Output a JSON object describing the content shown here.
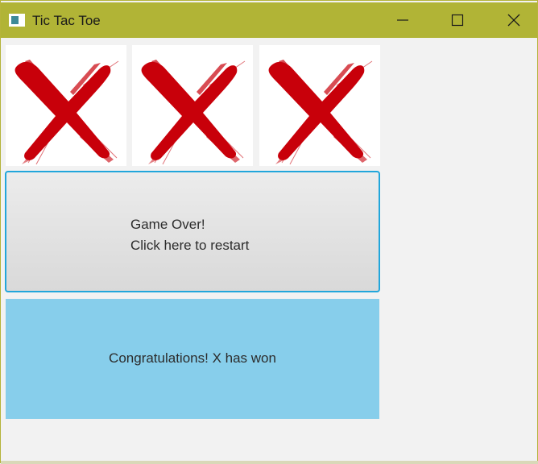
{
  "window": {
    "title": "Tic Tac Toe",
    "icon": "app-window-icon",
    "controls": [
      "minimize-icon",
      "maximize-icon",
      "close-icon"
    ],
    "titlebar_color": "#b1b436"
  },
  "board": {
    "cells": [
      {
        "mark": "X",
        "icon": "red-x-brush-icon"
      },
      {
        "mark": "X",
        "icon": "red-x-brush-icon"
      },
      {
        "mark": "X",
        "icon": "red-x-brush-icon"
      }
    ],
    "mark_color": "#c8000a"
  },
  "restart": {
    "line1": "Game Over!",
    "line2": "Click here to restart",
    "focus_color": "#22a6db"
  },
  "status": {
    "message": "Congratulations! X has won",
    "background": "#87ceeb"
  }
}
